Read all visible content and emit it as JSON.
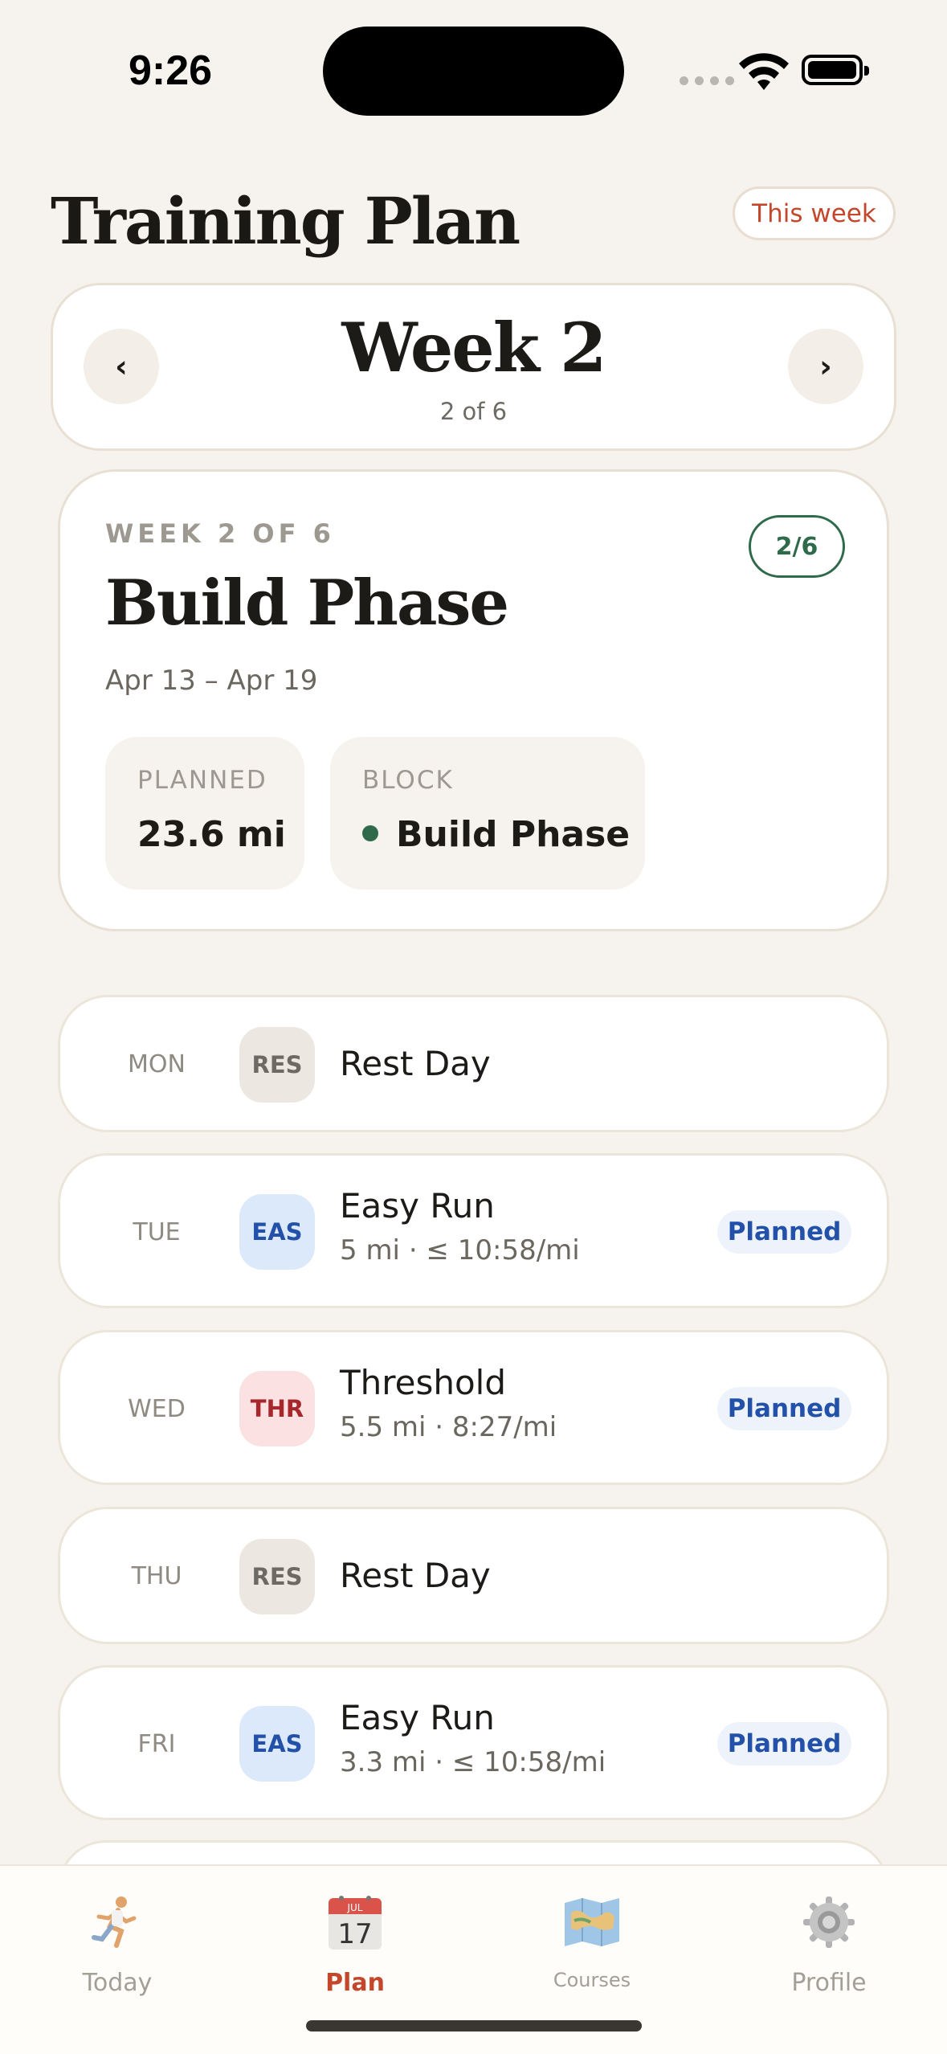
{
  "status": {
    "time": "9:26"
  },
  "header": {
    "title": "Training Plan",
    "this_week_label": "This week"
  },
  "week_selector": {
    "title": "Week 2",
    "subtitle": "2 of 6",
    "prev_glyph": "‹",
    "next_glyph": "›"
  },
  "phase": {
    "eyebrow": "WEEK 2 OF 6",
    "badge": "2/6",
    "title": "Build Phase",
    "dates": "Apr 13 – Apr 19",
    "planned_label": "PLANNED",
    "planned_value": "23.6 mi",
    "block_label": "BLOCK",
    "block_value": "Build Phase",
    "block_color": "#2f6b4a"
  },
  "days": [
    {
      "day": "MON",
      "code": "RES",
      "name": "Rest Day",
      "detail": "",
      "status": ""
    },
    {
      "day": "TUE",
      "code": "EAS",
      "name": "Easy Run",
      "detail": "5 mi · ≤ 10:58/mi",
      "status": "Planned"
    },
    {
      "day": "WED",
      "code": "THR",
      "name": "Threshold",
      "detail": "5.5 mi · 8:27/mi",
      "status": "Planned"
    },
    {
      "day": "THU",
      "code": "RES",
      "name": "Rest Day",
      "detail": "",
      "status": ""
    },
    {
      "day": "FRI",
      "code": "EAS",
      "name": "Easy Run",
      "detail": "3.3 mi · ≤ 10:58/mi",
      "status": "Planned"
    }
  ],
  "tabs": [
    {
      "label": "Today",
      "icon": "runner-icon"
    },
    {
      "label": "Plan",
      "icon": "calendar-icon",
      "calendar_month": "JUL",
      "calendar_day": "17"
    },
    {
      "label": "Courses",
      "icon": "map-icon"
    },
    {
      "label": "Profile",
      "icon": "gear-icon"
    }
  ],
  "colors": {
    "accent": "#c4472c",
    "background": "#f6f3ee",
    "easy": "#2350a8",
    "threshold": "#a6282d",
    "phase_green": "#2f6b4a"
  }
}
